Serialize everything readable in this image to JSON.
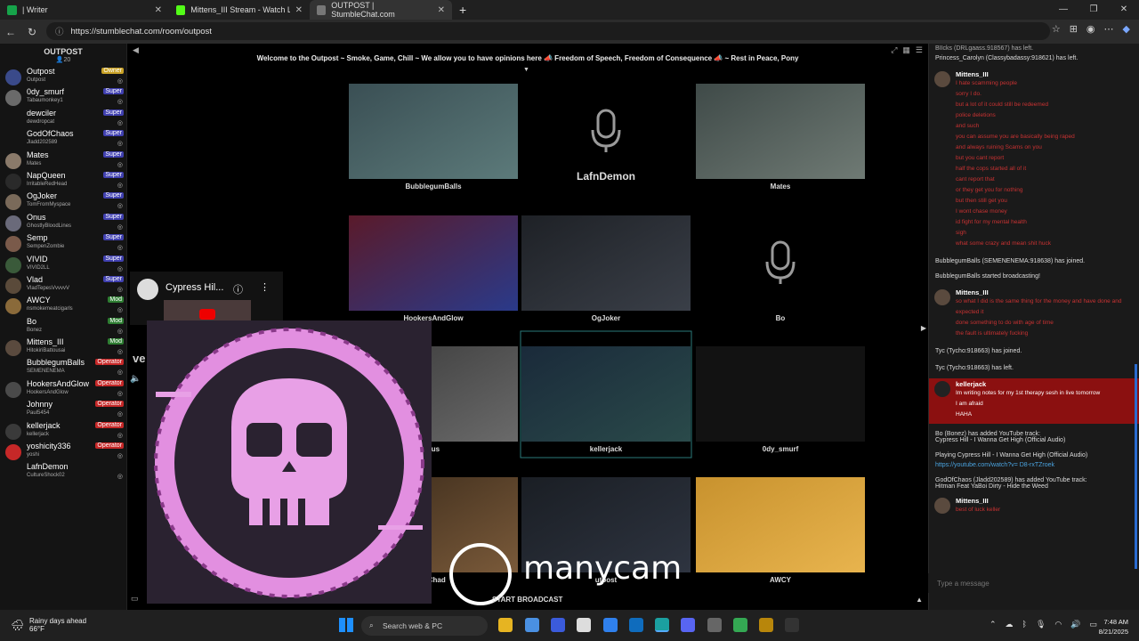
{
  "browser": {
    "tabs": [
      {
        "title": "| Writer",
        "color": "#16a34a"
      },
      {
        "title": "Mittens_III Stream - Watch Live o",
        "color": "#53fc18"
      },
      {
        "title": "OUTPOST | StumbleChat.com",
        "color": "#777777"
      }
    ],
    "url": "https://stumblechat.com/room/outpost"
  },
  "room": {
    "name": "OUTPOST",
    "count": "20",
    "welcome": "Welcome to the Outpost ~ Smoke, Game, Chill ~ We allow you to have opinions here 📣 Freedom of Speech, Freedom of Consequence 📣 ~ Rest in Peace, Pony"
  },
  "users": [
    {
      "name": "Outpost",
      "sub": "Outpost",
      "badge": "Owner",
      "badge_color": "#c9a227",
      "av": "#3a4a8a"
    },
    {
      "name": "0dy_smurf",
      "sub": "Tabaumonkey1",
      "badge": "Super",
      "badge_color": "#4040b0",
      "av": "#6a6a6a"
    },
    {
      "name": "dewciler",
      "sub": "dewdropcat",
      "badge": "Super",
      "badge_color": "#4040b0",
      "av": ""
    },
    {
      "name": "GodOfChaos",
      "sub": "Jladd202589",
      "badge": "Super",
      "badge_color": "#4040b0",
      "av": ""
    },
    {
      "name": "Mates",
      "sub": "Mates",
      "badge": "Super",
      "badge_color": "#4040b0",
      "av": "#8a7a6a"
    },
    {
      "name": "NapQueen",
      "sub": "IrritableRedHead",
      "badge": "Super",
      "badge_color": "#4040b0",
      "av": "#2a2a2a"
    },
    {
      "name": "OgJoker",
      "sub": "TomFromMyspace",
      "badge": "Super",
      "badge_color": "#4040b0",
      "av": "#7a6a5a"
    },
    {
      "name": "Onus",
      "sub": "GhostlyBloodLines",
      "badge": "Super",
      "badge_color": "#4040b0",
      "av": "#6a6a7a"
    },
    {
      "name": "Semp",
      "sub": "SempenZombie",
      "badge": "Super",
      "badge_color": "#4040b0",
      "av": "#7a5a4a"
    },
    {
      "name": "VIVID",
      "sub": "VIVID2LL",
      "badge": "Super",
      "badge_color": "#4040b0",
      "av": "#3a5a3a"
    },
    {
      "name": "Vlad",
      "sub": "VladTepesVvvvvV",
      "badge": "Super",
      "badge_color": "#4040b0",
      "av": "#5a4a3a"
    },
    {
      "name": "AWCY",
      "sub": "nsmokemeatcigarls",
      "badge": "Mod",
      "badge_color": "#2e7d32",
      "av": "#8a6a3a"
    },
    {
      "name": "Bo",
      "sub": "Bonez",
      "badge": "Mod",
      "badge_color": "#2e7d32",
      "av": ""
    },
    {
      "name": "Mittens_III",
      "sub": "HitokiriBattousai",
      "badge": "Mod",
      "badge_color": "#2e7d32",
      "av": "#5a4a3e"
    },
    {
      "name": "BubblegumBalls",
      "sub": "SEMENENEMA",
      "badge": "Operator",
      "badge_color": "#c62828",
      "av": ""
    },
    {
      "name": "HookersAndGlow",
      "sub": "HookersAndGlow",
      "badge": "Operator",
      "badge_color": "#c62828",
      "av": "#4a4a4a"
    },
    {
      "name": "Johnny",
      "sub": "Paul5454",
      "badge": "Operator",
      "badge_color": "#c62828",
      "av": ""
    },
    {
      "name": "kellerjack",
      "sub": "kellerjack",
      "badge": "Operator",
      "badge_color": "#c62828",
      "av": "#3a3a3a"
    },
    {
      "name": "yoshicity336",
      "sub": "yoshi",
      "badge": "Operator",
      "badge_color": "#c62828",
      "av": "#c62828"
    },
    {
      "name": "LafnDemon",
      "sub": "CultureShock02",
      "badge": "",
      "badge_color": "",
      "av": ""
    }
  ],
  "cams": [
    {
      "label": "BubblegumBalls",
      "type": "video",
      "colors": [
        "#3a4f54",
        "#5c7a7a"
      ]
    },
    {
      "label": "LafnDemon",
      "type": "mic"
    },
    {
      "label": "Mates",
      "type": "video",
      "colors": [
        "#3f4a48",
        "#6f7a74"
      ]
    },
    {
      "label": "HookersAndGlow",
      "type": "video",
      "colors": [
        "#5a1a2a",
        "#2a3a8a"
      ]
    },
    {
      "label": "OgJoker",
      "type": "video",
      "colors": [
        "#1e2126",
        "#3a3f48"
      ]
    },
    {
      "label": "Bo",
      "type": "mic"
    },
    {
      "label": "nus",
      "type": "video",
      "colors": [
        "#3a3a3a",
        "#6a6a6a"
      ]
    },
    {
      "label": "kellerjack",
      "type": "video",
      "colors": [
        "#1a2a3a",
        "#2a4a4a"
      ]
    },
    {
      "label": "0dy_smurf",
      "type": "blank"
    },
    {
      "label": "ofChad",
      "type": "video",
      "colors": [
        "#3a2a1a",
        "#7a5a3a"
      ]
    },
    {
      "label": "utpost",
      "type": "video",
      "colors": [
        "#1a1e24",
        "#2e3440"
      ]
    },
    {
      "label": "AWCY",
      "type": "video",
      "colors": [
        "#c8922e",
        "#e8b44e"
      ]
    }
  ],
  "overlay": {
    "yt_title": "Cypress Hil...",
    "manycam": "manycam",
    "start_broadcast": "START BROADCAST",
    "ve_text": "ve"
  },
  "chat": {
    "sys1": "BIIcks (DRLgaass.918567) has left.",
    "sys2": "Princess_Carolyn (Classybadassy:918621) has left.",
    "m1_name": "Mittens_III",
    "m1_lines": [
      "I hate scamming people",
      "sorry I do.",
      "but a lot of it could still be redeemed",
      "police deletions",
      "and such",
      "you can assume you are basically being raped",
      "and always ruining Scams on you",
      "but you cant report",
      "half the cops started all of it",
      "cant report that",
      "or they get you for nothing",
      "but then still get you",
      "I wont chase money",
      "id fight for my mental health",
      "sigh",
      "what some crazy and mean shit huck"
    ],
    "sys3": "BubblegumBalls (SEMENENEMA:918638) has joined.",
    "sys4": "BubblegumBalls started broadcasting!",
    "m2_name": "Mittens_III",
    "m2_lines": [
      "so what I did is the same thing for the money and have done and expected it",
      "done something to do with age of time",
      "the fault is ultimately fucking"
    ],
    "sys5": "Tyc (Tycho:918663) has joined.",
    "sys6": "Tyc (Tycho:918663) has left.",
    "m3_name": "kellerjack",
    "m3_lines": [
      "Im writing notes for my 1st therapy sesh in live tomorrow",
      "I am afraid",
      "HAHA"
    ],
    "sys7": "Bo (Bonez) has added YouTube track:",
    "sys7b": "Cypress Hill - I Wanna Get High (Official Audio)",
    "sys8": "Playing Cypress Hill - I Wanna Get High (Official Audio)",
    "link": "https://youtube.com/watch?v= D8-rxTZroek",
    "sys9": "GodOfChaos (Jladd202589) has added YouTube track:",
    "sys9b": "Hitman Feat YaBoi Dirty - Hide the Weed",
    "m4_name": "Mittens_III",
    "m4_lines": [
      "best of luck keller"
    ],
    "placeholder": "Type a message"
  },
  "taskbar": {
    "weather_title": "Rainy days ahead",
    "weather_temp": "66°F",
    "search": "Search web & PC",
    "time": "7:48 AM",
    "date": "8/21/2025"
  }
}
